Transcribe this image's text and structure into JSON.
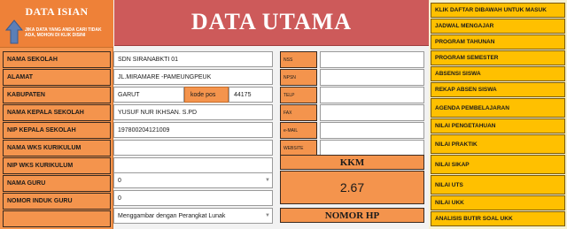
{
  "left": {
    "title": "DATA ISIAN",
    "note": "JIKA DATA YANG ANDA CARI TIDAK ADA, MOHON DI KLIK DISINI",
    "labels": [
      "NAMA SEKOLAH",
      "ALAMAT",
      "KABUPATEN",
      "NAMA KEPALA SEKOLAH",
      "NIP KEPALA SEKOLAH",
      "NAMA WKS KURIKULUM",
      "NIP WKS KURIKULUM",
      "NAMA GURU",
      "NOMOR INDUK GURU",
      ""
    ]
  },
  "header": {
    "title": "DATA UTAMA"
  },
  "fields": {
    "nama_sekolah": "SDN SIRANABKTI 01",
    "alamat": "JL.MIRAMARE -PAMEUNGPEUK",
    "kabupaten": "GARUT",
    "kode_pos_label": "kode pos",
    "kode_pos": "44175",
    "kepala_sekolah": "YUSUF NUR IKHSAN. S.PD",
    "nip_kepala": "197800204121009",
    "wks_kurikulum": "",
    "nip_wks": "",
    "nama_guru": "0",
    "nomor_induk_guru": "0",
    "mapel": "Menggambar dengan Perangkat Lunak"
  },
  "contact": {
    "labels": [
      "NSS",
      "NPSN",
      "TELP",
      "FAX",
      "e-MAIL",
      "WEBSITE"
    ]
  },
  "kkm": {
    "label": "KKM",
    "value": "2.67"
  },
  "nohp": {
    "label": "NOMOR HP"
  },
  "menu": {
    "items": [
      "KLIK DAFTAR DIBAWAH UNTUK MASUK",
      "JADWAL MENGAJAR",
      "PROGRAM TAHUNAN",
      "PROGRAM SEMESTER",
      "ABSENSI SISWA",
      "REKAP ABSEN SISWA",
      "AGENDA PEMBELAJARAN",
      "NILAI PENGETAHUAN",
      "NILAI PRAKTIK",
      "NILAI SIKAP",
      "NILAI UTS",
      "NILAI UKK",
      "ANALISIS BUTIR SOAL UKK"
    ]
  },
  "colors": {
    "orange": "#f4944d",
    "header_red": "#cd5a5a",
    "menu_yellow": "#ffc000"
  }
}
